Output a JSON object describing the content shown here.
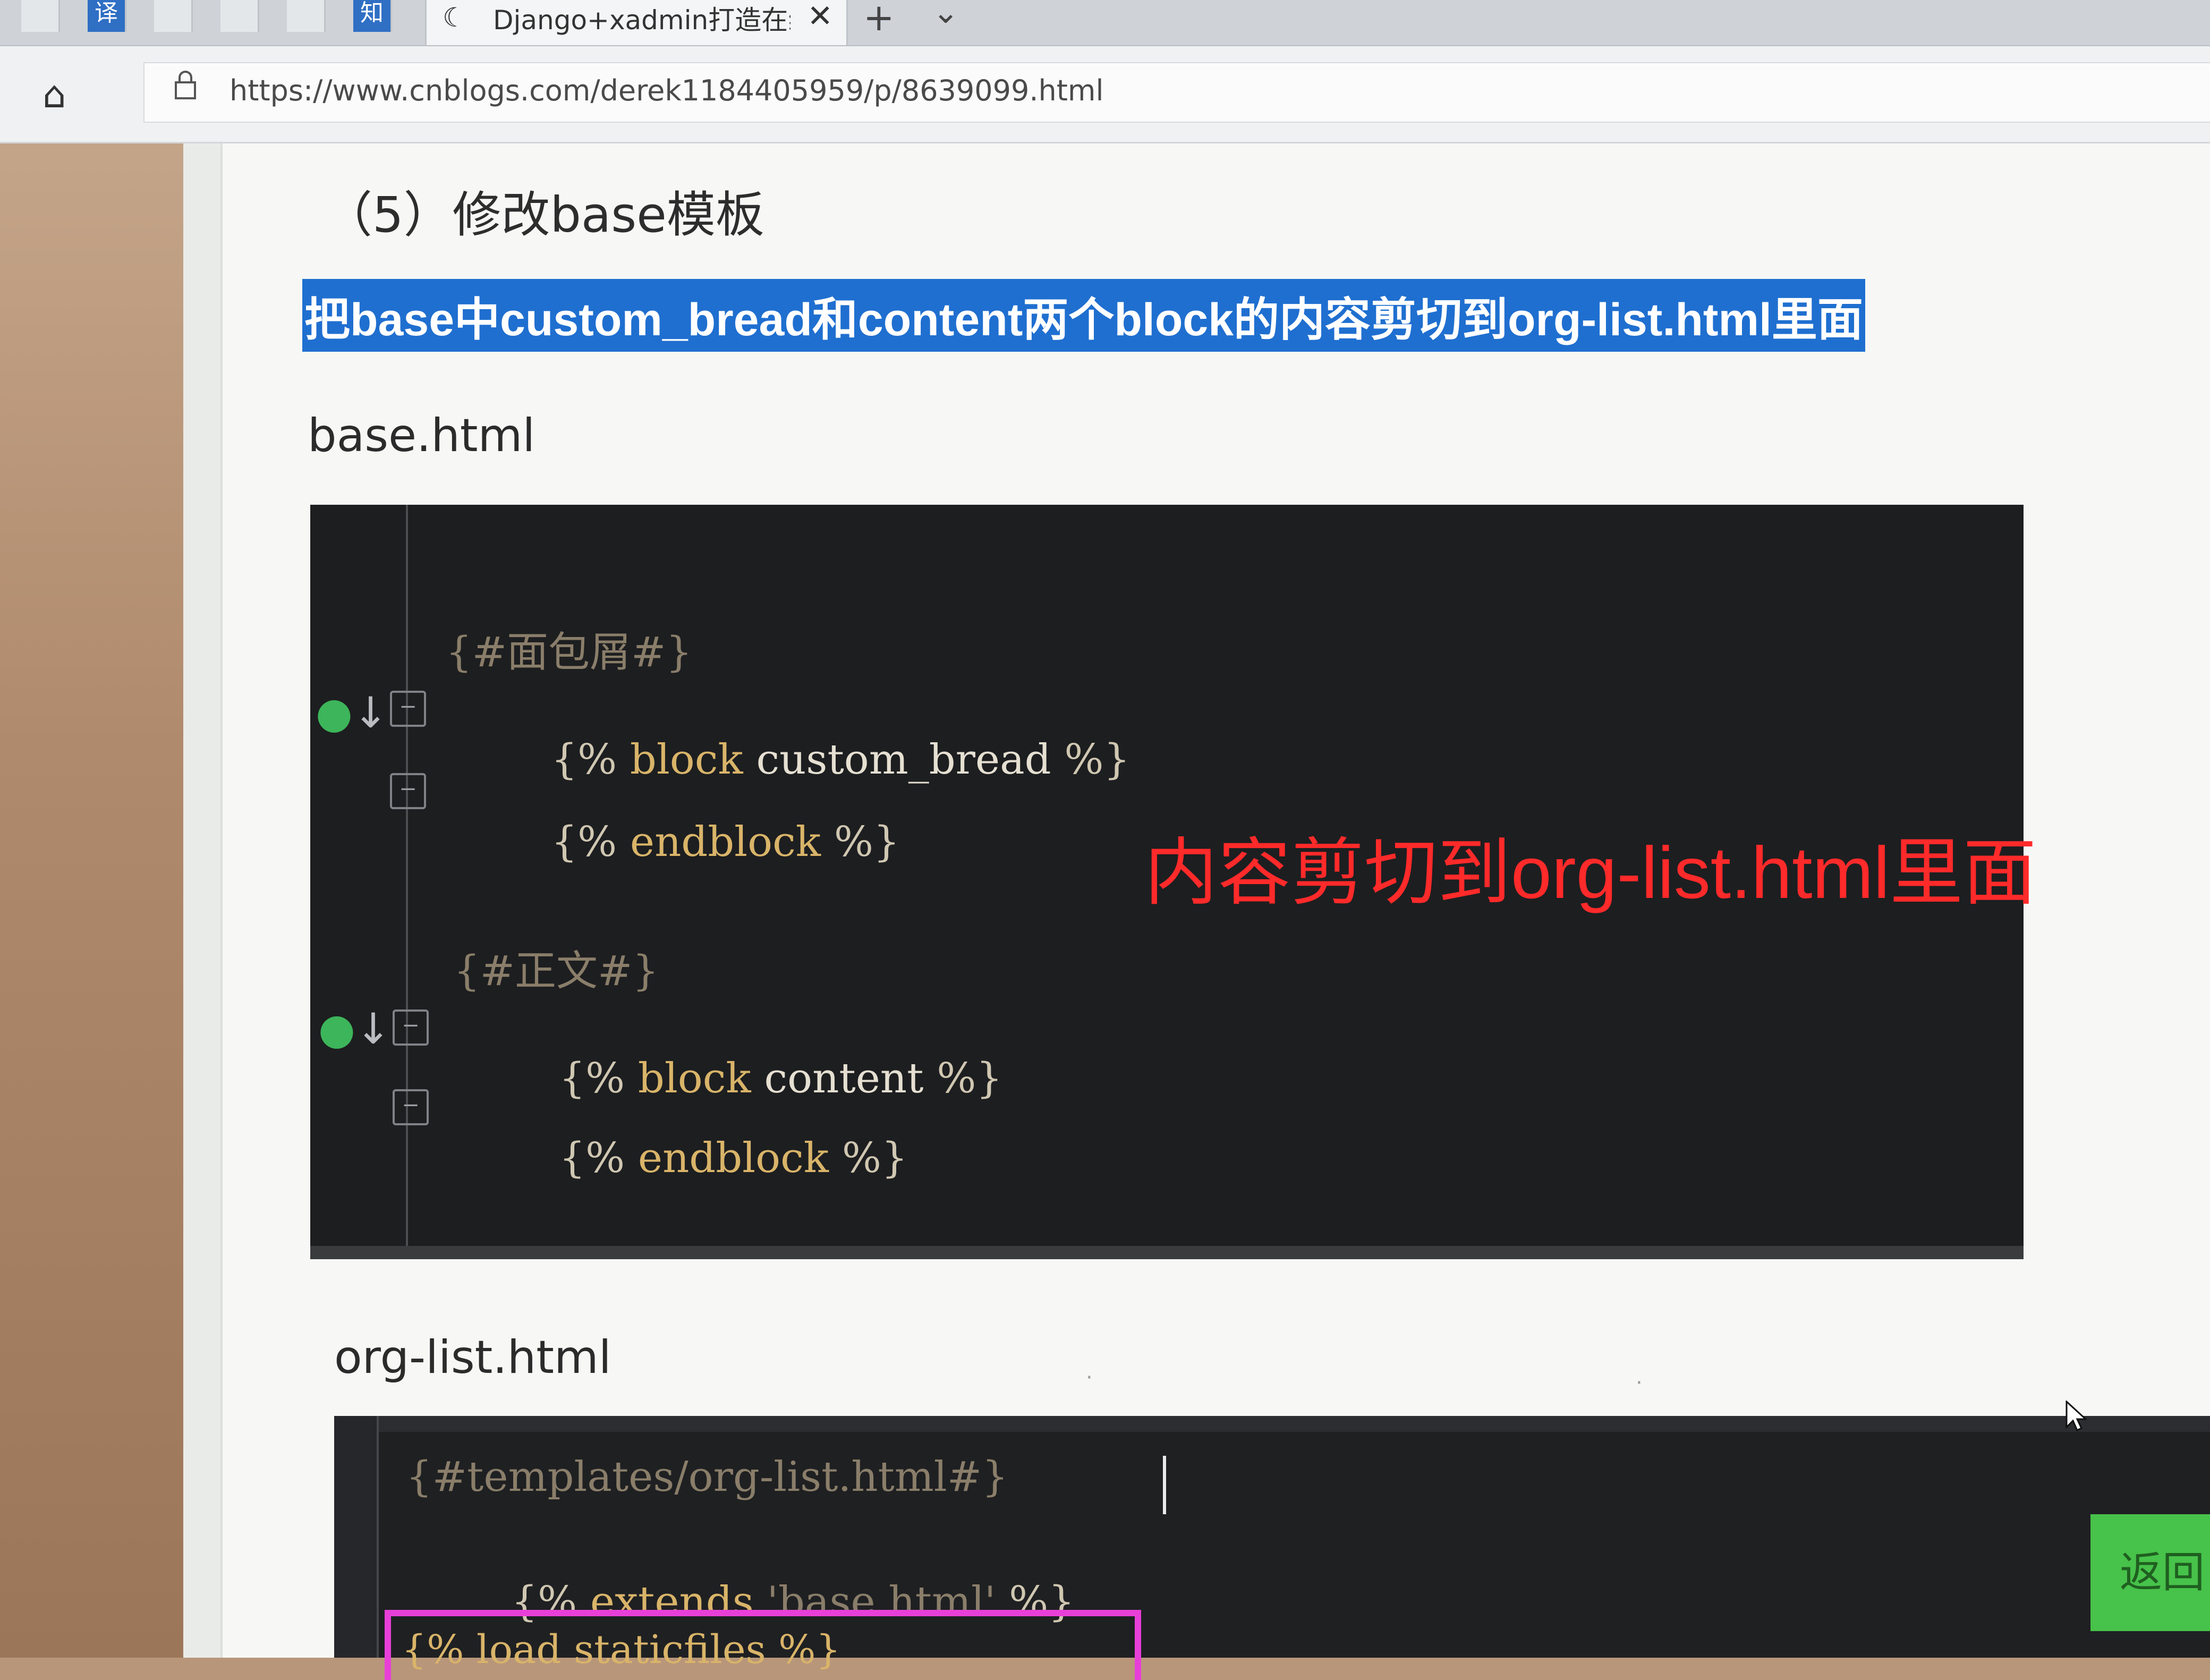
{
  "browser": {
    "tab_icons": [
      "",
      "译",
      "",
      "",
      "",
      "知"
    ],
    "active_tab": {
      "favicon": "☾",
      "title": "Django+xadmin打造在线",
      "close": "✕"
    },
    "new_tab": "+",
    "tab_menu": "⌄",
    "home_icon": "⌂",
    "lock_icon": "🔒",
    "url": "https://www.cnblogs.com/derek1184405959/p/8639099.html"
  },
  "article": {
    "section_heading": "（5）修改base模板",
    "highlighted_instruction": "把base中custom_bread和content两个block的内容剪切到org-list.html里面",
    "base_file_label": "base.html",
    "org_file_label": "org-list.html"
  },
  "code_block_1": {
    "lines": [
      {
        "comment": "{#面包屑#}"
      },
      {
        "open": "{%",
        "keyword": "block",
        "name": "custom_bread",
        "close": "%}"
      },
      {
        "open": "{%",
        "keyword": "endblock",
        "name": "",
        "close": "%}"
      },
      {
        "comment": "{#正文#}"
      },
      {
        "open": "{%",
        "keyword": "block",
        "name": "content",
        "close": "%}"
      },
      {
        "open": "{%",
        "keyword": "endblock",
        "name": "",
        "close": "%}"
      }
    ],
    "annotation": "内容剪切到org-list.html里面"
  },
  "code_block_2": {
    "lines": [
      {
        "comment": "{#templates/org-list.html#}"
      },
      {
        "open": "{%",
        "keyword": "extends",
        "string": "'base.html'",
        "close": "%}"
      },
      {
        "text": "{% load staticfiles %}"
      }
    ]
  },
  "back_button": {
    "label": "返回"
  },
  "colors": {
    "highlight": "#1f6fd0",
    "annotation_red": "#ff2a2a",
    "code_bg": "#1d1e20",
    "keyword": "#d9b469",
    "magenta_box": "#e83fd8",
    "back_button_green": "#47c24a"
  },
  "icons": {
    "home": "home-icon",
    "lock": "lock-icon",
    "close": "close-icon",
    "cursor": "mouse-pointer-icon"
  }
}
